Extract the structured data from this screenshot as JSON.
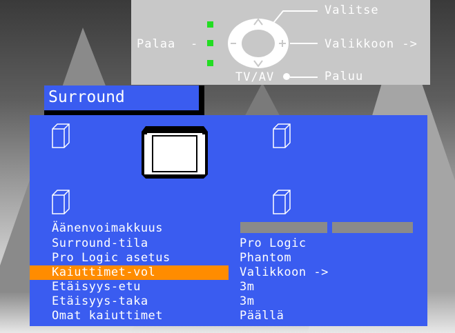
{
  "help": {
    "back_label": "Palaa",
    "dash": "-",
    "select_label": "Valitse",
    "menu_label": "Valikkoon ->",
    "tvav_label": "TV/AV",
    "return_label": "Paluu",
    "dot_color": "#22dd22"
  },
  "menu": {
    "title": "Surround",
    "rows": [
      {
        "label": "Äänenvoimakkuus",
        "value": ""
      },
      {
        "label": "Surround-tila",
        "value": "Pro Logic"
      },
      {
        "label": "Pro Logic asetus",
        "value": "Phantom"
      },
      {
        "label": "Kaiuttimet-vol",
        "value": "Valikkoon ->"
      },
      {
        "label": "Etäisyys-etu",
        "value": "3m"
      },
      {
        "label": "Etäisyys-taka",
        "value": "3m"
      },
      {
        "label": "Omat kaiuttimet",
        "value": "Päällä"
      }
    ],
    "selected_index": 3,
    "panel_color": "#3a5cf0",
    "highlight_color": "#ff8c00"
  }
}
